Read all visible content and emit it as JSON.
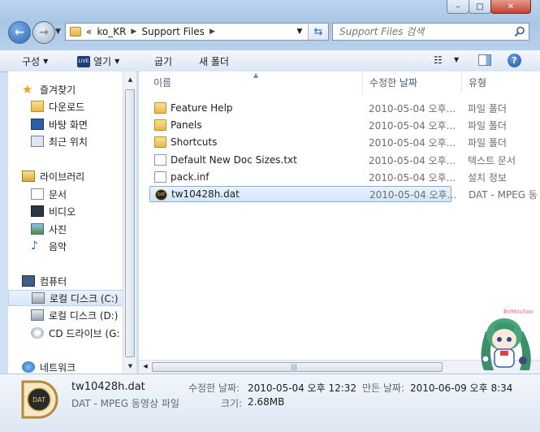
{
  "window": {
    "min": "–",
    "max": "□",
    "close": "✕"
  },
  "address": {
    "overflow": "«",
    "crumbs": [
      "ko_KR",
      "Support Files"
    ]
  },
  "search": {
    "placeholder": "Support Files 검색"
  },
  "toolbar": {
    "organize": "구성",
    "burn": "열기",
    "share": "굽기",
    "new_folder": "새 폴더"
  },
  "nav": {
    "favorites": "즐겨찾기",
    "fav_items": [
      "다운로드",
      "바탕 화면",
      "최근 위치"
    ],
    "libraries": "라이브러리",
    "lib_items": [
      "문서",
      "비디오",
      "사진",
      "음악"
    ],
    "computer": "컴퓨터",
    "comp_items": [
      "로컬 디스크 (C:)",
      "로컬 디스크 (D:)",
      "CD 드라이브 (G:"
    ],
    "network": "네트워크"
  },
  "columns": {
    "name": "이름",
    "date": "수정한 날짜",
    "type": "유형"
  },
  "files": [
    {
      "name": "Feature Help",
      "date": "2010-05-04 오후...",
      "type": "파일 폴더",
      "icon": "folder"
    },
    {
      "name": "Panels",
      "date": "2010-05-04 오후...",
      "type": "파일 폴더",
      "icon": "folder"
    },
    {
      "name": "Shortcuts",
      "date": "2010-05-04 오후...",
      "type": "파일 폴더",
      "icon": "folder"
    },
    {
      "name": "Default New Doc Sizes.txt",
      "date": "2010-05-04 오후...",
      "type": "텍스트 문서",
      "icon": "text-doc"
    },
    {
      "name": "pack.inf",
      "date": "2010-05-04 오후...",
      "type": "설치 정보",
      "icon": "setup-info"
    },
    {
      "name": "tw10428h.dat",
      "date": "2010-05-04 오후...",
      "type": "DAT - MPEG 동",
      "icon": "dat-file"
    }
  ],
  "details": {
    "icon_text": "DAT",
    "file_name": "tw10428h.dat",
    "file_type": "DAT - MPEG 동영상 파일",
    "modified_label": "수정한 날짜:",
    "modified_value": "2010-05-04 오후 12:32",
    "created_label": "만든 날짜:",
    "created_value": "2010-06-09 오후 8:34",
    "size_label": "크기:",
    "size_value": "2.68MB"
  },
  "watermark": "BoMouSoo",
  "colors": {
    "selection": "#d2e6fb",
    "chrome": "#b8d1ec"
  }
}
